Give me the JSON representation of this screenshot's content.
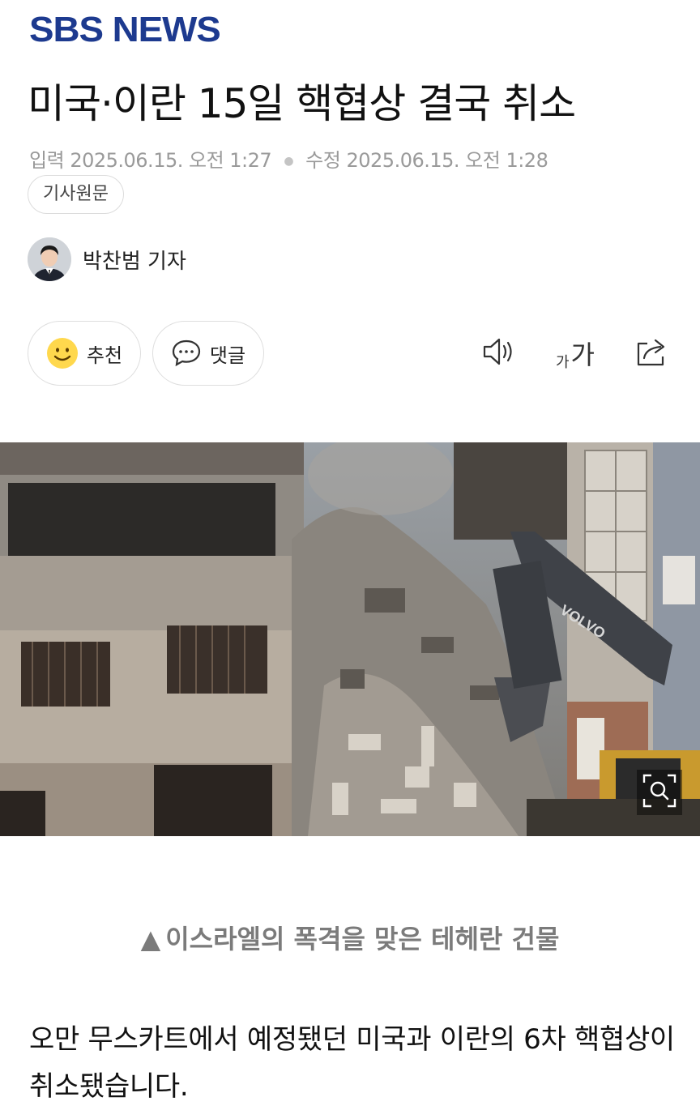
{
  "header": {
    "logo_text": "SBS NEWS",
    "brand_color": "#1d3a8f"
  },
  "article": {
    "title": "미국·이란 15일 핵협상 결국 취소",
    "meta": {
      "input_label": "입력",
      "input_time": "2025.06.15. 오전 1:27",
      "modified_label": "수정",
      "modified_time": "2025.06.15. 오전 1:28"
    },
    "original_button": "기사원문",
    "reporter": "박찬범 기자",
    "actions": {
      "recommend": "추천",
      "comment": "댓글",
      "font_small": "가",
      "font_large": "가"
    },
    "caption_marker": "▲",
    "caption": "이스라엘의 폭격을 맞은 테헤란 건물",
    "body": "오만 무스카트에서 예정됐던 미국과 이란의 6차 핵협상이 취소됐습니다."
  },
  "icons": {
    "recommend": "smiley-icon",
    "comment": "speech-bubble-icon",
    "tts": "speaker-icon",
    "font_size": "font-size-icon",
    "share": "share-icon",
    "zoom": "zoom-icon"
  },
  "colors": {
    "meta_text": "#9a9a9a",
    "caption_text": "#7b7b7b",
    "smiley": "#ffd84d"
  }
}
